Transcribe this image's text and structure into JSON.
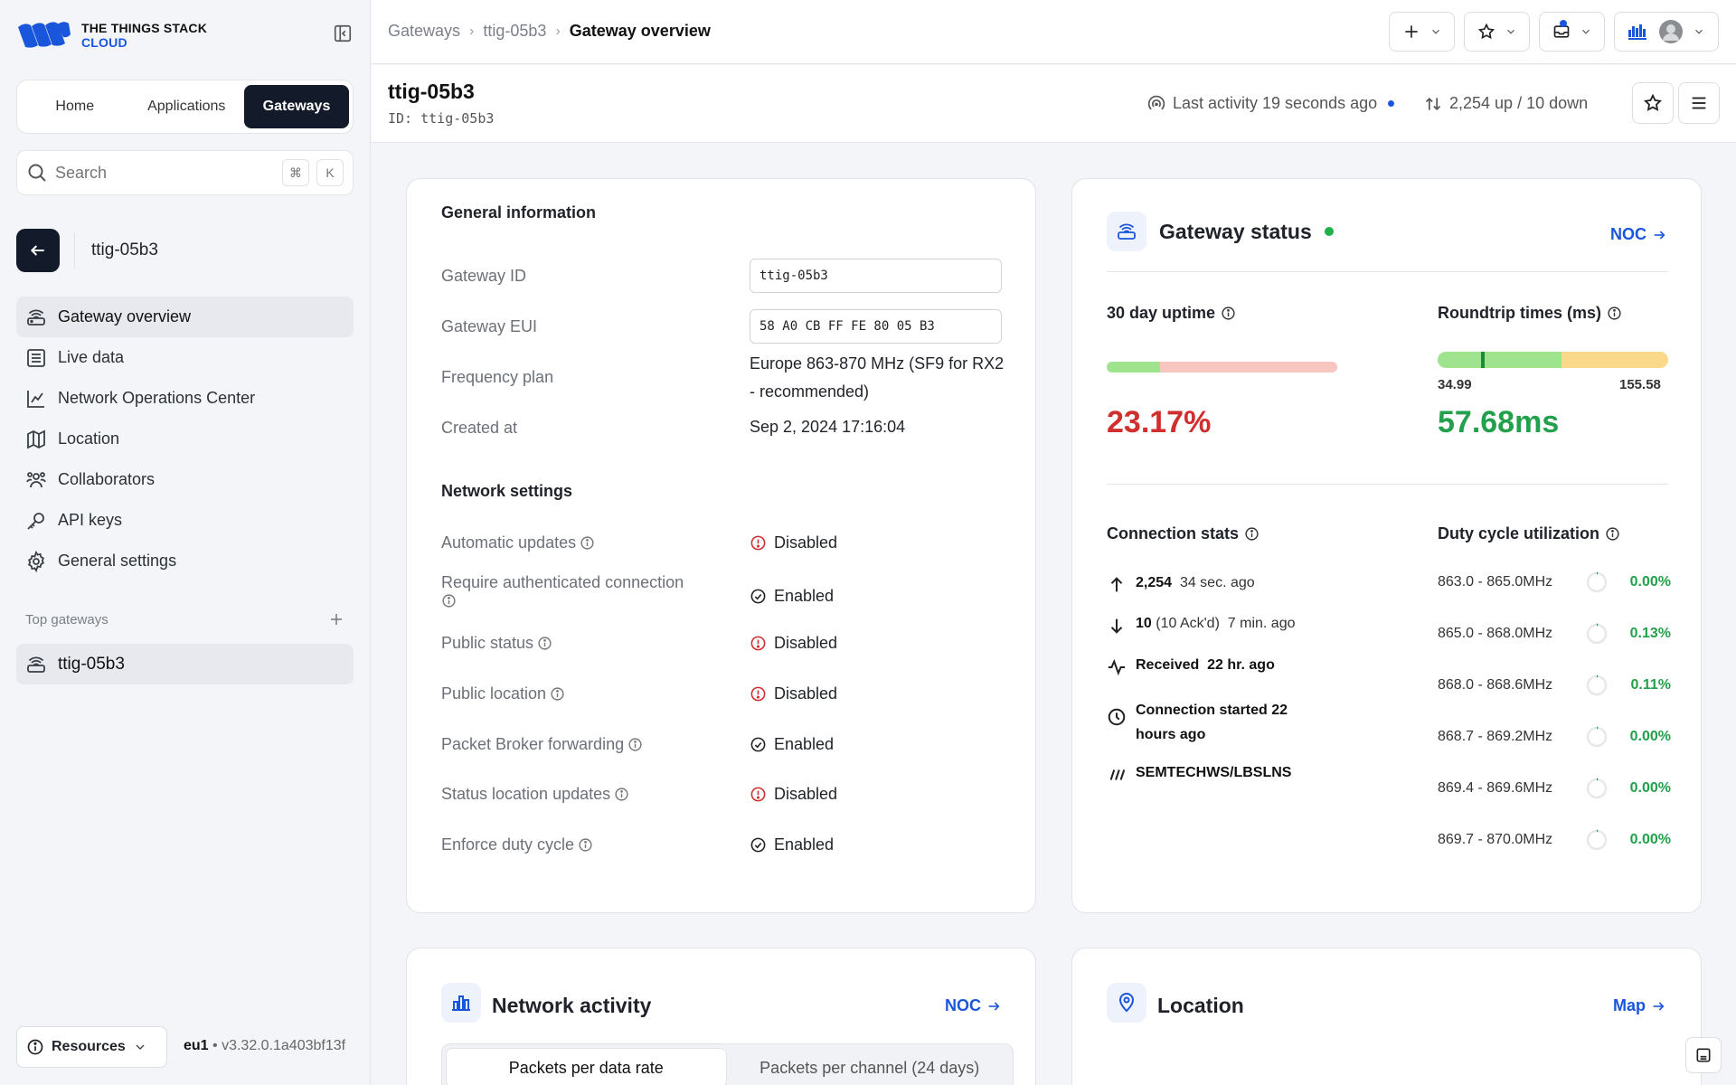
{
  "brand": {
    "line1": "THE THINGS STACK",
    "line2": "CLOUD",
    "accent": "#1a56db"
  },
  "switcher": {
    "items": [
      "Home",
      "Applications",
      "Gateways"
    ],
    "active": "Gateways"
  },
  "search": {
    "placeholder": "Search",
    "kbd1": "⌘",
    "kbd2": "K"
  },
  "entity": {
    "name": "ttig-05b3"
  },
  "nav": [
    {
      "label": "Gateway overview",
      "icon": "gateway-icon",
      "active": true
    },
    {
      "label": "Live data",
      "icon": "list-icon"
    },
    {
      "label": "Network Operations Center",
      "icon": "chart-icon"
    },
    {
      "label": "Location",
      "icon": "map-icon"
    },
    {
      "label": "Collaborators",
      "icon": "users-icon"
    },
    {
      "label": "API keys",
      "icon": "key-icon"
    },
    {
      "label": "General settings",
      "icon": "gear-icon"
    }
  ],
  "top_gateways": {
    "title": "Top gateways",
    "items": [
      "ttig-05b3"
    ]
  },
  "footer": {
    "resources": "Resources",
    "cluster": "eu1",
    "version": "v3.32.0.1a403bf13f"
  },
  "breadcrumb": [
    "Gateways",
    "ttig-05b3",
    "Gateway overview"
  ],
  "header": {
    "title": "ttig-05b3",
    "id_label": "ID:",
    "id_value": "ttig-05b3",
    "last_activity": "Last activity 19 seconds ago",
    "traffic": "2,254 up / 10 down"
  },
  "general": {
    "title": "General information",
    "rows": [
      {
        "label": "Gateway ID",
        "value": "ttig-05b3",
        "type": "code"
      },
      {
        "label": "Gateway EUI",
        "value": "58 A0 CB FF FE 80 05 B3",
        "type": "code"
      },
      {
        "label": "Frequency plan",
        "value": "Europe 863-870 MHz (SF9 for RX2 - recommended)",
        "type": "text"
      },
      {
        "label": "Created at",
        "value": "Sep 2, 2024 17:16:04",
        "type": "text"
      }
    ]
  },
  "network": {
    "title": "Network settings",
    "rows": [
      {
        "label": "Automatic updates",
        "value": "Disabled",
        "enabled": false
      },
      {
        "label": "Require authenticated connection",
        "value": "Enabled",
        "enabled": true
      },
      {
        "label": "Public status",
        "value": "Disabled",
        "enabled": false
      },
      {
        "label": "Public location",
        "value": "Disabled",
        "enabled": false
      },
      {
        "label": "Packet Broker forwarding",
        "value": "Enabled",
        "enabled": true
      },
      {
        "label": "Status location updates",
        "value": "Disabled",
        "enabled": false
      },
      {
        "label": "Enforce duty cycle",
        "value": "Enabled",
        "enabled": true
      }
    ]
  },
  "status": {
    "title": "Gateway status",
    "noc_link": "NOC",
    "uptime": {
      "label": "30 day uptime",
      "value": "23.17%",
      "fraction": 0.2317
    },
    "roundtrip": {
      "label": "Roundtrip times (ms)",
      "min": "34.99",
      "max": "155.58",
      "value": "57.68ms"
    },
    "connection": {
      "label": "Connection stats",
      "up_count": "2,254",
      "up_time": "34 sec. ago",
      "down_count": "10",
      "down_acked": "(10 Ack'd)",
      "down_time": "7 min. ago",
      "received_label": "Received",
      "received_time": "22 hr. ago",
      "started": "Connection started 22 hours ago",
      "protocol": "SEMTECHWS/LBSLNS"
    },
    "duty": {
      "label": "Duty cycle utilization",
      "rows": [
        {
          "freq": "863.0 - 865.0MHz",
          "pct": "0.00%"
        },
        {
          "freq": "865.0 - 868.0MHz",
          "pct": "0.13%"
        },
        {
          "freq": "868.0 - 868.6MHz",
          "pct": "0.11%"
        },
        {
          "freq": "868.7 - 869.2MHz",
          "pct": "0.00%"
        },
        {
          "freq": "869.4 - 869.6MHz",
          "pct": "0.00%"
        },
        {
          "freq": "869.7 - 870.0MHz",
          "pct": "0.00%"
        }
      ]
    }
  },
  "activity": {
    "title": "Network activity",
    "noc_link": "NOC",
    "tabs": [
      "Packets per data rate",
      "Packets per channel (24 days)"
    ]
  },
  "location": {
    "title": "Location",
    "map_link": "Map"
  },
  "colors": {
    "danger": "#d12e2e",
    "success": "#22a04b",
    "dark": "#131a2a"
  }
}
